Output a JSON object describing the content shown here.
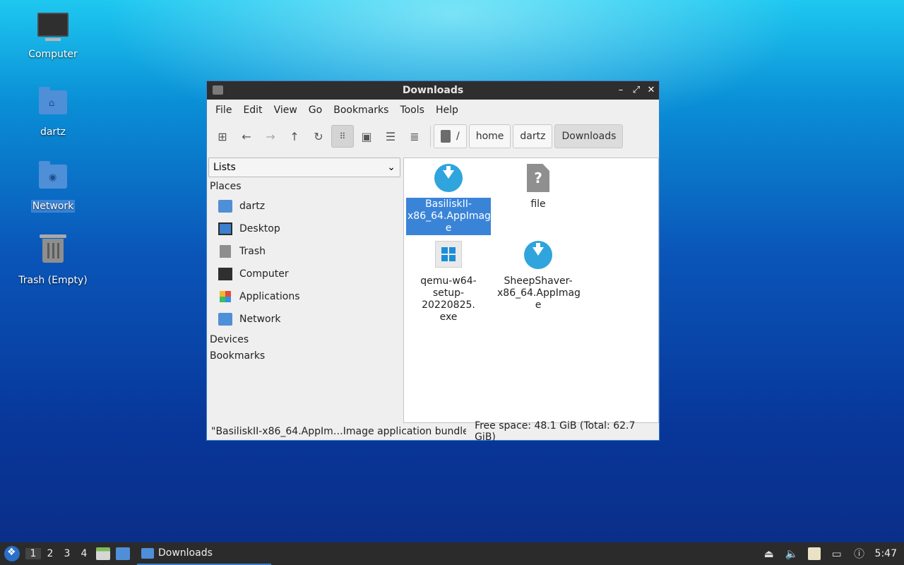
{
  "desktop": {
    "icons": [
      {
        "label": "Computer",
        "icon": "computer-icon"
      },
      {
        "label": "dartz",
        "icon": "home-folder-icon"
      },
      {
        "label": "Network",
        "icon": "network-folder-icon"
      },
      {
        "label": "Trash (Empty)",
        "icon": "trash-icon"
      }
    ]
  },
  "window": {
    "title": "Downloads",
    "menu": [
      "File",
      "Edit",
      "View",
      "Go",
      "Bookmarks",
      "Tools",
      "Help"
    ],
    "breadcrumb": [
      "/",
      "home",
      "dartz",
      "Downloads"
    ],
    "sidebar": {
      "mode": "Lists",
      "places_header": "Places",
      "places": [
        "dartz",
        "Desktop",
        "Trash",
        "Computer",
        "Applications",
        "Network"
      ],
      "devices_header": "Devices",
      "bookmarks_header": "Bookmarks"
    },
    "files": [
      {
        "name": "BasiliskII-x86_64.AppImage",
        "lines": [
          "BasiliskII-",
          "x86_64.AppImag",
          "e"
        ],
        "icon": "appimage-icon",
        "selected": true
      },
      {
        "name": "file",
        "lines": [
          "file"
        ],
        "icon": "unknown-file-icon",
        "selected": false
      },
      {
        "name": "qemu-w64-setup-20220825.exe",
        "lines": [
          "qemu-w64-",
          "setup-20220825.",
          "exe"
        ],
        "icon": "windows-exe-icon",
        "selected": false
      },
      {
        "name": "SheepShaver-x86_64.AppImage",
        "lines": [
          "SheepShaver-",
          "x86_64.AppImag",
          "e"
        ],
        "icon": "appimage-icon",
        "selected": false
      }
    ],
    "status": {
      "selection": "\"BasiliskII-x86_64.AppIm…Image application bundle",
      "free_space": "Free space: 48.1 GiB (Total: 62.7 GiB)"
    }
  },
  "taskbar": {
    "workspaces": [
      "1",
      "2",
      "3",
      "4"
    ],
    "active_workspace": "1",
    "task_label": "Downloads",
    "clock": "5:47"
  },
  "colors": {
    "accent": "#3a84d8",
    "titlebar": "#2e2e2e",
    "taskbar": "#2b2b2b"
  }
}
